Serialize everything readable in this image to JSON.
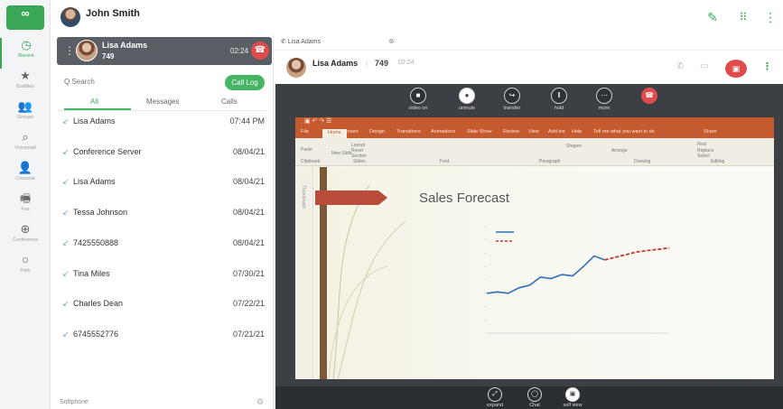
{
  "app": {
    "logo_text": "",
    "logo_subtext": ""
  },
  "user": {
    "name": "John Smith",
    "status": ""
  },
  "rail": [
    {
      "name": "recent",
      "label": "Recent",
      "icon": "clock-icon",
      "active": true
    },
    {
      "name": "buddies",
      "label": "Buddies",
      "icon": "star-icon"
    },
    {
      "name": "groups",
      "label": "Groups",
      "icon": "groups-icon"
    },
    {
      "name": "voicemail",
      "label": "Voicemail",
      "icon": "voicemail-icon"
    },
    {
      "name": "contacts",
      "label": "Contacts",
      "icon": "contacts-icon"
    },
    {
      "name": "fax",
      "label": "Fax",
      "icon": "fax-icon"
    },
    {
      "name": "conference",
      "label": "Conference",
      "icon": "conference-icon"
    },
    {
      "name": "park",
      "label": "Park",
      "icon": "park-icon"
    }
  ],
  "active_call": {
    "name": "Lisa Adams",
    "ext": "749",
    "time": "02:24"
  },
  "search": {
    "placeholder": "Q Search"
  },
  "call_log_button": "Call Log",
  "tabs": [
    "All",
    "Messages",
    "Calls"
  ],
  "recents": [
    {
      "name": "Lisa Adams",
      "sub": "",
      "date": "07:44 PM"
    },
    {
      "name": "Conference Server",
      "sub": "",
      "date": "08/04/21"
    },
    {
      "name": "Lisa Adams",
      "sub": "",
      "date": "08/04/21"
    },
    {
      "name": "Tessa Johnson",
      "sub": "",
      "date": "08/04/21"
    },
    {
      "name": "7425550888",
      "sub": "",
      "date": "08/04/21"
    },
    {
      "name": "Tina Miles",
      "sub": "",
      "date": "07/30/21"
    },
    {
      "name": "Charles Dean",
      "sub": "",
      "date": "07/22/21"
    },
    {
      "name": "6745552776",
      "sub": "",
      "date": "07/21/21"
    }
  ],
  "softphone_label": "Softphone",
  "conversation": {
    "tab_label": "Lisa Adams",
    "name": "Lisa Adams",
    "ext": "749",
    "time": "02:24",
    "sub": ""
  },
  "video_controls": [
    {
      "label": "video on",
      "icon": "video-icon"
    },
    {
      "label": "unmute",
      "icon": "mic-icon",
      "style": "white"
    },
    {
      "label": "transfer",
      "icon": "transfer-icon"
    },
    {
      "label": "hold",
      "icon": "pause-icon"
    },
    {
      "label": "more",
      "icon": "more-icon"
    },
    {
      "label": "",
      "icon": "hangup-icon",
      "style": "red"
    }
  ],
  "bottom_controls": [
    {
      "label": "expand",
      "icon": "expand-icon"
    },
    {
      "label": "Chat",
      "icon": "chat-icon"
    },
    {
      "label": "self view",
      "icon": "self-view-icon",
      "style": "white"
    }
  ],
  "bottom_text": "",
  "ppt": {
    "window_title": "",
    "account": "",
    "menu": [
      "File",
      "Home",
      "Insert",
      "Design",
      "Transitions",
      "Animations",
      "Slide Show",
      "Review",
      "View",
      "Add-ins",
      "Help",
      "Tell me what you want to do",
      "Share"
    ],
    "ribbon_groups": [
      "Clipboard",
      "Slides",
      "Font",
      "Paragraph",
      "Drawing",
      "Editing"
    ],
    "ribbon_items": [
      "Paste",
      "New Slide",
      "Layout",
      "Reset",
      "Section",
      "Shapes",
      "Arrange",
      "Find",
      "Replace",
      "Select"
    ],
    "thumbs_label": "Thumbnails",
    "slide_title": "Sales Forecast"
  },
  "chart_data": {
    "type": "line",
    "title": "",
    "series": [
      {
        "values": [
          3.0,
          3.1,
          3.0,
          3.4,
          3.6,
          4.2,
          4.1,
          4.4,
          4.3,
          5.0,
          5.8,
          5.5,
          null,
          null,
          null,
          null,
          null,
          null
        ]
      },
      {
        "values": [
          null,
          null,
          null,
          null,
          null,
          null,
          null,
          null,
          null,
          null,
          null,
          5.5,
          5.7,
          5.9,
          6.1,
          6.2,
          6.3,
          6.4
        ]
      }
    ],
    "colors": [
      "#2f6fb4",
      "#c0392b"
    ],
    "ylim": [
      0,
      8
    ],
    "grid": false
  }
}
